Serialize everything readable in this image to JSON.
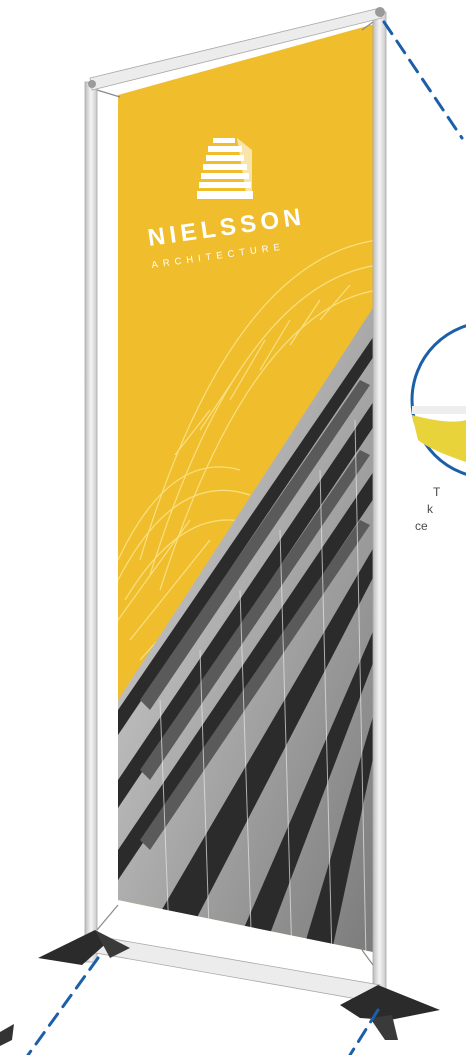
{
  "product": {
    "type": "banner stand display"
  },
  "banner": {
    "brand_name": "NIELSSON",
    "brand_tagline": "ARCHITECTURE",
    "background_color": "#f0be2c",
    "logo_icon": "building-icon"
  },
  "side_caption": {
    "lines": [
      "T",
      "k",
      "ce"
    ]
  },
  "colors": {
    "frame": "#e6e6e6",
    "frame_shadow": "#b8b8b8",
    "callout": "#1b5fa8",
    "feet": "#2b2b2b"
  }
}
